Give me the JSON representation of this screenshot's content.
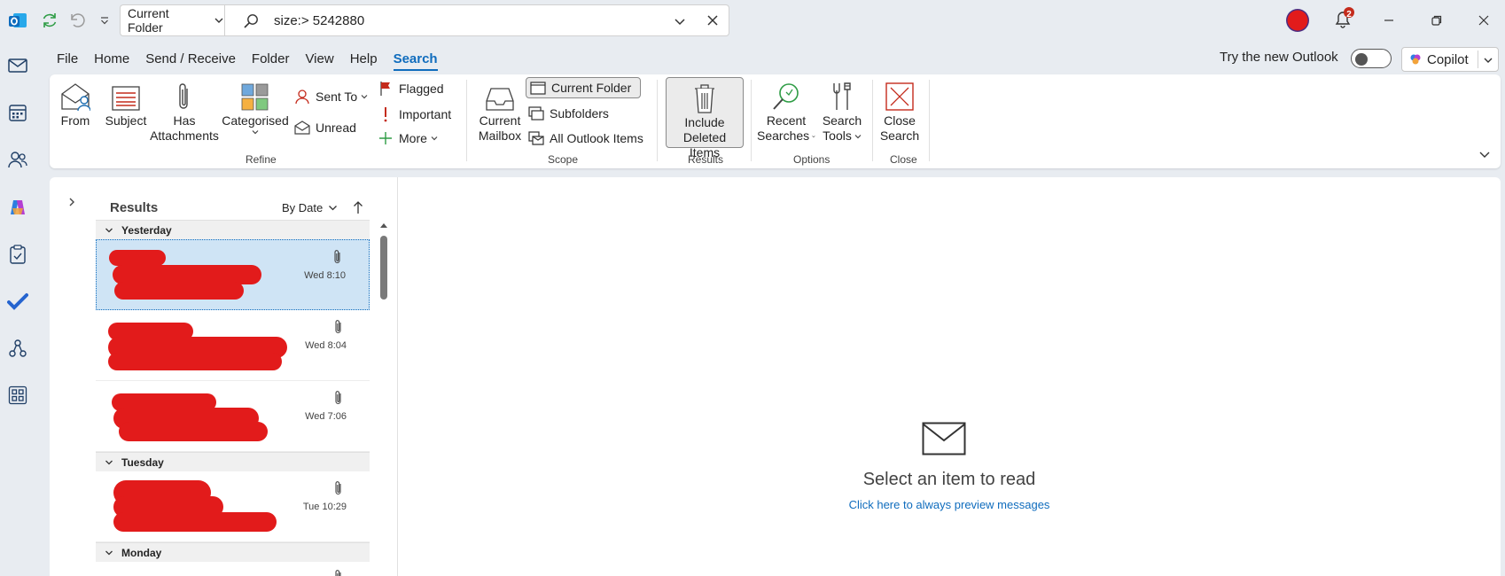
{
  "titlebar": {
    "scope_label": "Current Folder",
    "search_query": "size:> 5242880",
    "notification_count": "2",
    "colors": {
      "accent": "#0f6cbd",
      "avatar": "#e21b1b",
      "badge": "#c42b1c"
    }
  },
  "rail": {
    "items": [
      "mail-icon",
      "calendar-icon",
      "people-icon",
      "copilot-icon",
      "tasks-icon",
      "todo-icon",
      "org-icon",
      "apps-icon"
    ]
  },
  "menu": {
    "tabs": [
      "File",
      "Home",
      "Send / Receive",
      "Folder",
      "View",
      "Help",
      "Search"
    ],
    "active": "Search"
  },
  "topright": {
    "try_new": "Try the new Outlook",
    "copilot": "Copilot"
  },
  "ribbon": {
    "refine": {
      "from": "From",
      "subject": "Subject",
      "has_attachments_1": "Has",
      "has_attachments_2": "Attachments",
      "categorised": "Categorised",
      "sent_to": "Sent To",
      "unread": "Unread",
      "flagged": "Flagged",
      "important": "Important",
      "more": "More",
      "label": "Refine"
    },
    "scope": {
      "current_mailbox_1": "Current",
      "current_mailbox_2": "Mailbox",
      "current_folder": "Current Folder",
      "subfolders": "Subfolders",
      "all_outlook_items": "All Outlook Items",
      "label": "Scope"
    },
    "results": {
      "include_1": "Include",
      "include_2": "Deleted Items",
      "label": "Results"
    },
    "options": {
      "recent_1": "Recent",
      "recent_2": "Searches",
      "tools_1": "Search",
      "tools_2": "Tools",
      "label": "Options"
    },
    "close": {
      "close_1": "Close",
      "close_2": "Search",
      "label": "Close"
    }
  },
  "list": {
    "header": "Results",
    "sort": "By Date",
    "groups": [
      {
        "label": "Yesterday"
      },
      {
        "label": "Tuesday"
      },
      {
        "label": "Monday"
      }
    ],
    "messages": [
      {
        "time": "Wed 8:10"
      },
      {
        "time": "Wed 8:04"
      },
      {
        "time": "Wed 7:06"
      },
      {
        "time": "Tue 10:29"
      }
    ]
  },
  "reading": {
    "empty_title": "Select an item to read",
    "preview_link": "Click here to always preview messages"
  }
}
